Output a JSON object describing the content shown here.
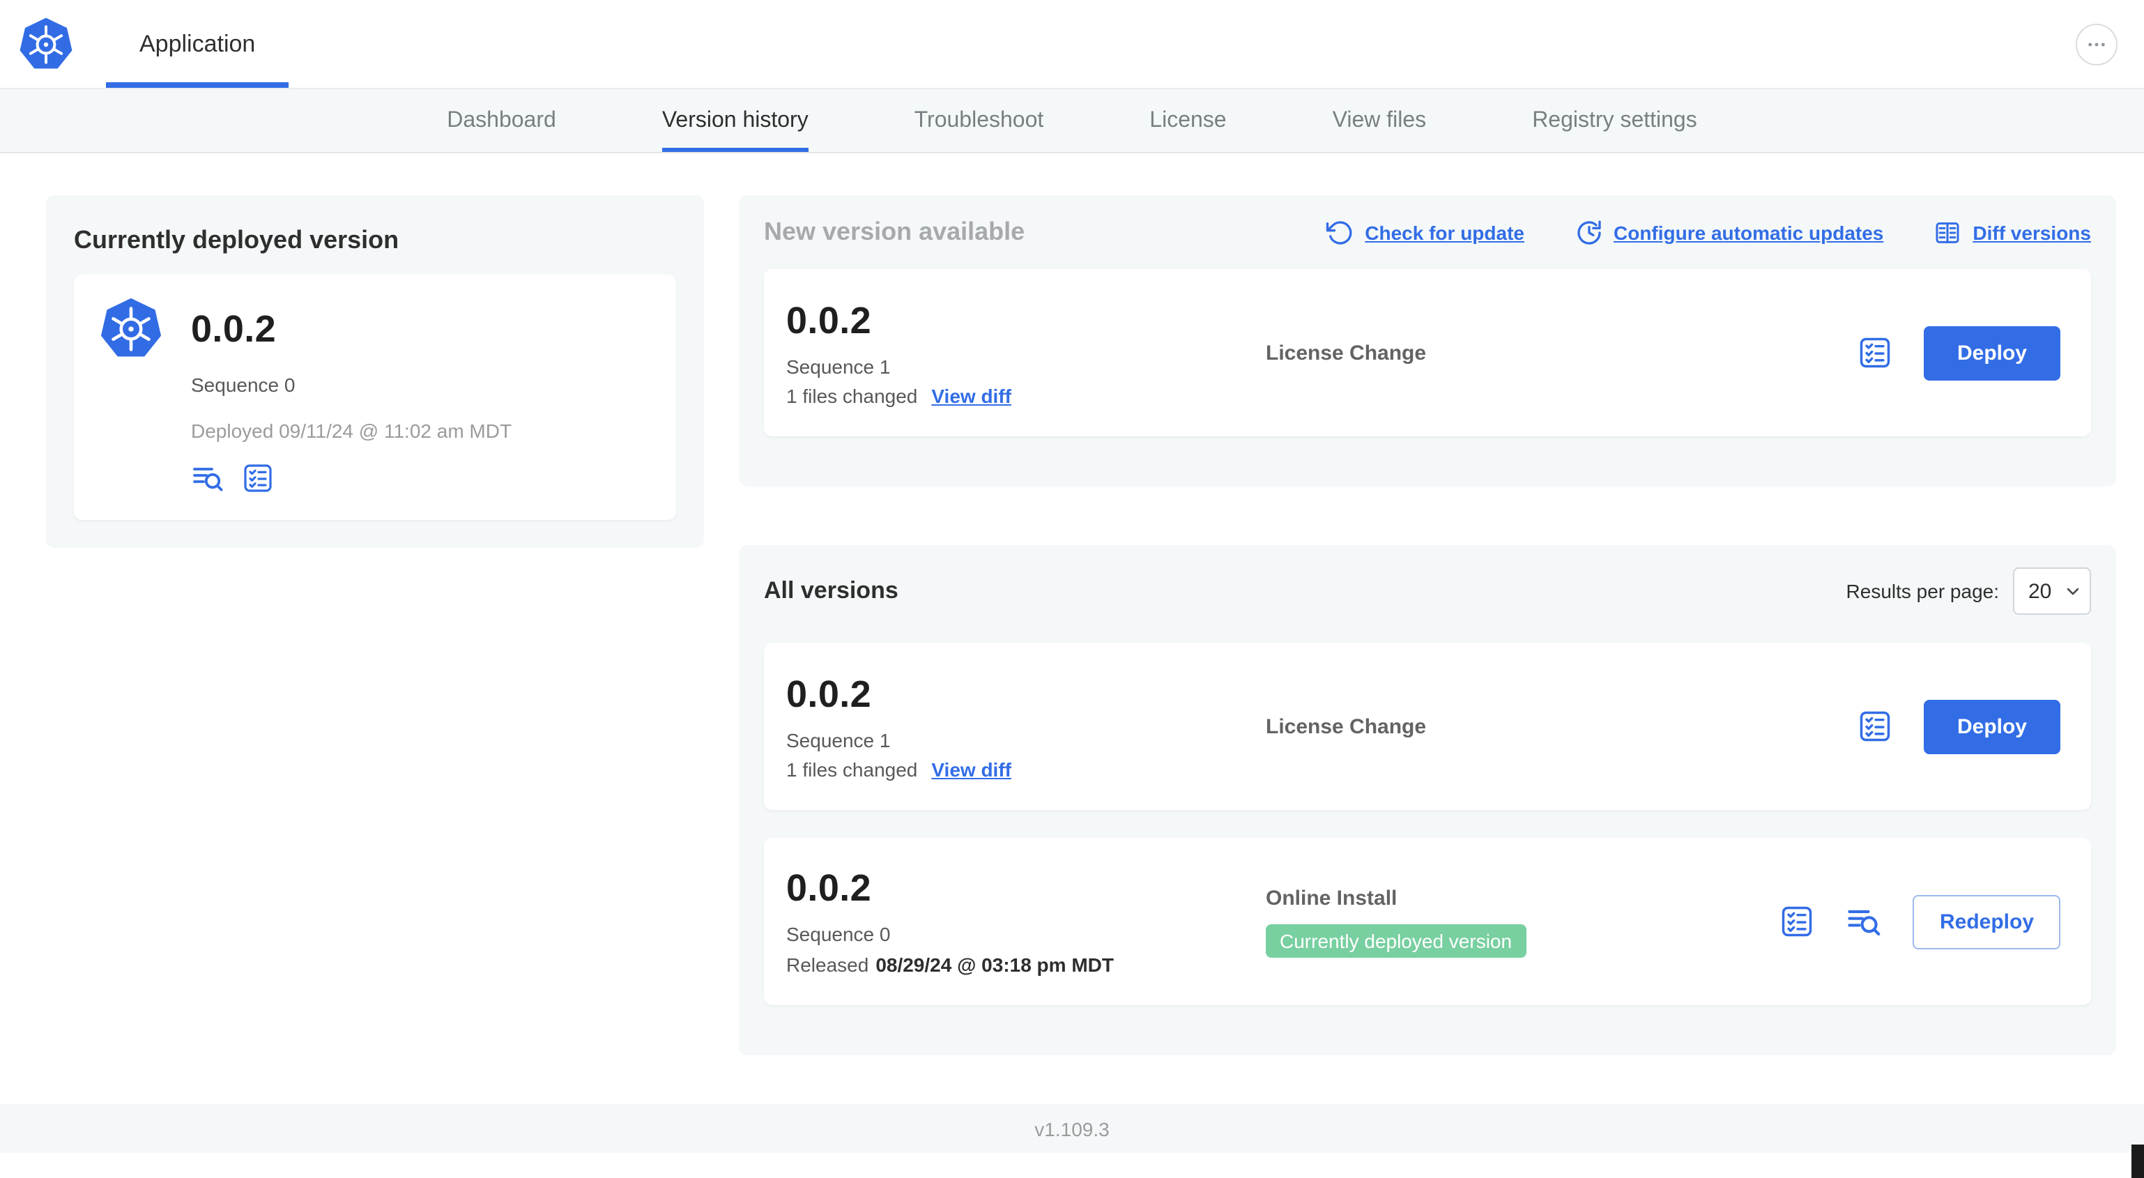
{
  "colors": {
    "accent": "#326de6",
    "badge-green": "#78cfa0"
  },
  "topbar": {
    "app_tab": "Application"
  },
  "nav": {
    "active_tab": "Version history",
    "tabs": [
      {
        "label": "Dashboard"
      },
      {
        "label": "Version history"
      },
      {
        "label": "Troubleshoot"
      },
      {
        "label": "License"
      },
      {
        "label": "View files"
      },
      {
        "label": "Registry settings"
      }
    ]
  },
  "current_version": {
    "heading": "Currently deployed version",
    "version": "0.0.2",
    "sequence": "Sequence 0",
    "deployed": "Deployed 09/11/24 @ 11:02 am MDT"
  },
  "new_version": {
    "heading": "New version available",
    "check_for_update": "Check for update",
    "configure_automatic_updates": "Configure automatic updates",
    "diff_versions": "Diff versions",
    "card": {
      "version": "0.0.2",
      "sequence": "Sequence 1",
      "files_changed": "1 files changed",
      "view_diff": "View diff",
      "source": "License Change",
      "deploy": "Deploy"
    }
  },
  "all_versions": {
    "heading": "All versions",
    "results_per_page_label": "Results per page:",
    "results_per_page": "20",
    "rows": [
      {
        "version": "0.0.2",
        "sequence": "Sequence 1",
        "files_changed": "1 files changed",
        "view_diff": "View diff",
        "source": "License Change",
        "action": "Deploy"
      },
      {
        "version": "0.0.2",
        "sequence": "Sequence 0",
        "released_prefix": "Released",
        "released_date": "08/29/24 @ 03:18 pm MDT",
        "source": "Online Install",
        "badge": "Currently deployed version",
        "action": "Redeploy"
      }
    ]
  },
  "footer": {
    "version": "v1.109.3"
  }
}
